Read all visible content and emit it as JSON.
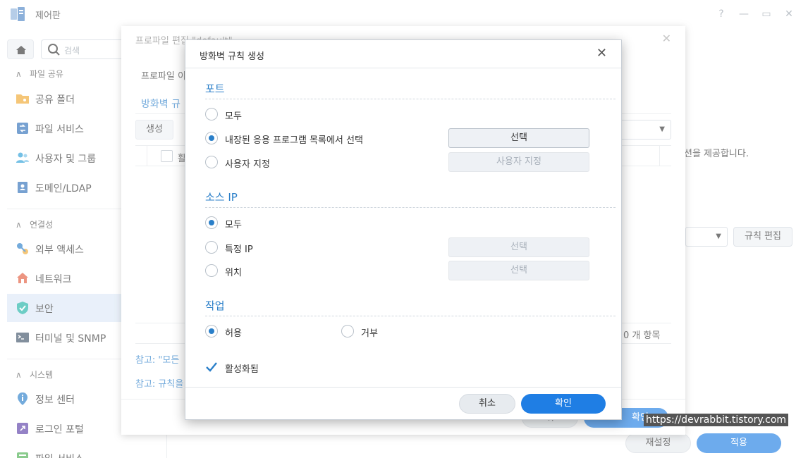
{
  "window": {
    "title": "제어판",
    "controls": {
      "help": "?",
      "minimize": "—",
      "maximize": "▭",
      "close": "✕"
    }
  },
  "sidebar": {
    "search_placeholder": "검색",
    "sections": [
      {
        "label": "파일 공유",
        "items": [
          "공유 폴더",
          "파일 서비스",
          "사용자 및 그룹",
          "도메인/LDAP"
        ]
      },
      {
        "label": "연결성",
        "items": [
          "외부 액세스",
          "네트워크",
          "보안",
          "터미널 및 SNMP"
        ]
      },
      {
        "label": "시스템",
        "items": [
          "정보 센터",
          "로그인 포털",
          "파일 서비스"
        ]
      }
    ],
    "active_item": "보안"
  },
  "main_background": {
    "provide_text": "션을 제공합니다.",
    "rule_edit_button": "규칙 편집",
    "reset_button": "재설정",
    "apply_button": "적용"
  },
  "profile_dialog": {
    "title": "프로파일 편집 \"default\"",
    "profile_label": "프로파일 이",
    "firewall_rules_tab": "방화벽 규",
    "create_button": "생성",
    "column_fragment": "활",
    "item_count": "0 개 항목",
    "note1": "참고: \"모든",
    "note2": "참고: 규칙을",
    "confirm_fragment": "확인",
    "cancel_fragment": "취"
  },
  "firewall_dialog": {
    "title": "방화벽 규칙 생성",
    "port": {
      "title": "포트",
      "options": [
        "모두",
        "내장된 응용 프로그램 목록에서 선택",
        "사용자 지정"
      ],
      "selected_index": 1,
      "select_button": "선택",
      "custom_button": "사용자 지정"
    },
    "source_ip": {
      "title": "소스 IP",
      "options": [
        "모두",
        "특정 IP",
        "위치"
      ],
      "selected_index": 0,
      "select_button_specific": "선택",
      "select_button_location": "선택"
    },
    "action": {
      "title": "작업",
      "options": [
        "허용",
        "거부"
      ],
      "selected_index": 0
    },
    "enabled_label": "활성화됨",
    "enabled": true,
    "cancel_button": "취소",
    "ok_button": "확인"
  },
  "watermark": "https://devrabbit.tistory.com",
  "colors": {
    "accent": "#1f7ee4",
    "section_title": "#2a7fc9",
    "active_nav": "#dde9f7"
  }
}
